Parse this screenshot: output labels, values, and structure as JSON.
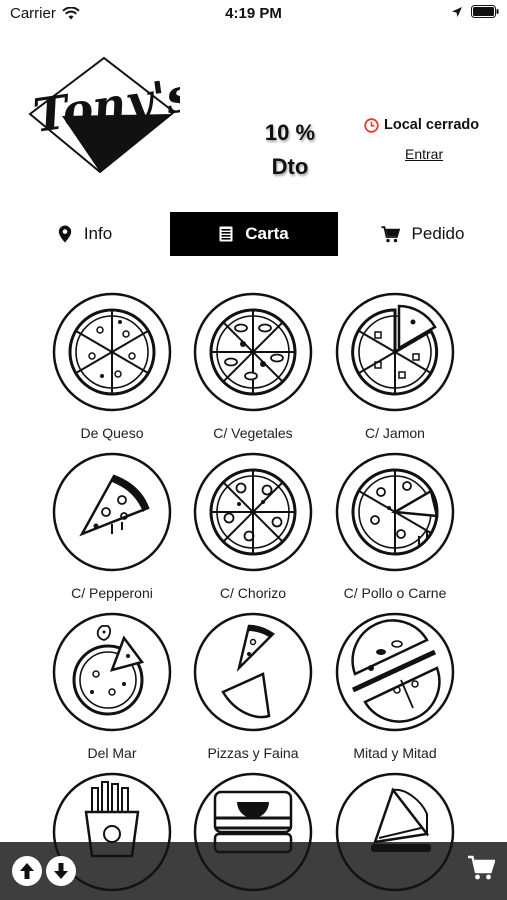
{
  "status_bar": {
    "carrier": "Carrier",
    "time": "4:19 PM"
  },
  "header": {
    "logo_text": "Tony's",
    "discount": "10 %",
    "discount_unit": "Dto",
    "store_status": "Local cerrado",
    "enter_link": "Entrar",
    "status_color": "#e53935"
  },
  "tabs": [
    {
      "label": "Info",
      "icon": "map-pin-icon"
    },
    {
      "label": "Carta",
      "icon": "menu-list-icon",
      "selected": true
    },
    {
      "label": "Pedido",
      "icon": "cart-icon"
    }
  ],
  "menu": {
    "items": [
      {
        "label": "De Queso",
        "icon": "cheese-pizza-icon"
      },
      {
        "label": "C/ Vegetales",
        "icon": "vegetable-pizza-icon"
      },
      {
        "label": "C/ Jamon",
        "icon": "ham-pizza-icon"
      },
      {
        "label": "C/ Pepperoni",
        "icon": "pizza-slice-icon"
      },
      {
        "label": "C/ Chorizo",
        "icon": "chorizo-pizza-icon"
      },
      {
        "label": "C/ Pollo o Carne",
        "icon": "chicken-pizza-icon"
      },
      {
        "label": "Del Mar",
        "icon": "seafood-pizza-icon"
      },
      {
        "label": "Pizzas y Faina",
        "icon": "pizza-faina-icon"
      },
      {
        "label": "Mitad y Mitad",
        "icon": "half-half-pizza-icon"
      },
      {
        "label": "",
        "icon": "fries-icon"
      },
      {
        "label": "",
        "icon": "sandwich-icon"
      },
      {
        "label": "",
        "icon": "sandwich-wedge-icon"
      }
    ]
  },
  "bottom_bar": {
    "scroll_up": "arrow-up-icon",
    "scroll_down": "arrow-down-icon",
    "cart": "cart-icon"
  }
}
